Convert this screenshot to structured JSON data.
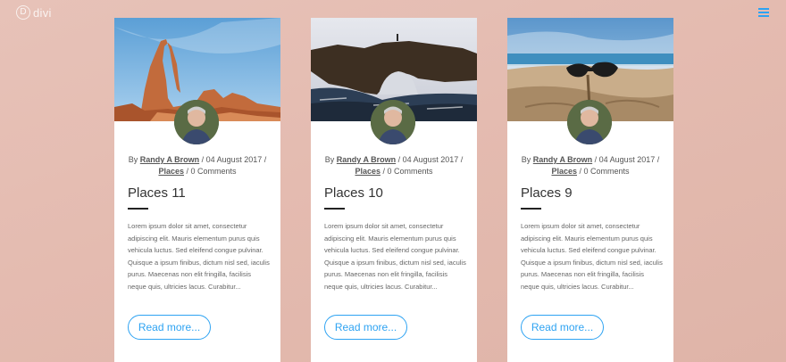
{
  "brand": {
    "logo_letter": "D",
    "name": "divi"
  },
  "posts": [
    {
      "author_prefix": "By",
      "author": "Randy A Brown",
      "date": "/ 04 August 2017 /",
      "category": "Places",
      "comments": "/ 0 Comments",
      "title": "Places 11",
      "excerpt": "Lorem ipsum dolor sit amet, consectetur adipiscing elit. Mauris elementum purus quis vehicula luctus. Sed eleifend congue pulvinar. Quisque a ipsum finibus, dictum nisl sed, iaculis purus. Maecenas non elit fringilla, facilisis neque quis, ultricies lacus. Curabitur...",
      "read_more": "Read more..."
    },
    {
      "author_prefix": "By",
      "author": "Randy A Brown",
      "date": "/ 04 August 2017 /",
      "category": "Places",
      "comments": "/ 0 Comments",
      "title": "Places 10",
      "excerpt": "Lorem ipsum dolor sit amet, consectetur adipiscing elit. Mauris elementum purus quis vehicula luctus. Sed eleifend congue pulvinar. Quisque a ipsum finibus, dictum nisl sed, iaculis purus. Maecenas non elit fringilla, facilisis neque quis, ultricies lacus. Curabitur...",
      "read_more": "Read more..."
    },
    {
      "author_prefix": "By",
      "author": "Randy A Brown",
      "date": "/ 04 August 2017 /",
      "category": "Places",
      "comments": "/ 0 Comments",
      "title": "Places 9",
      "excerpt": "Lorem ipsum dolor sit amet, consectetur adipiscing elit. Mauris elementum purus quis vehicula luctus. Sed eleifend congue pulvinar. Quisque a ipsum finibus, dictum nisl sed, iaculis purus. Maecenas non elit fringilla, facilisis neque quis, ultricies lacus. Curabitur...",
      "read_more": "Read more..."
    }
  ],
  "colors": {
    "accent": "#2ea3f2",
    "background": "#e4bbb0",
    "card": "#ffffff"
  },
  "icons": {
    "menu": "hamburger-menu-icon"
  }
}
